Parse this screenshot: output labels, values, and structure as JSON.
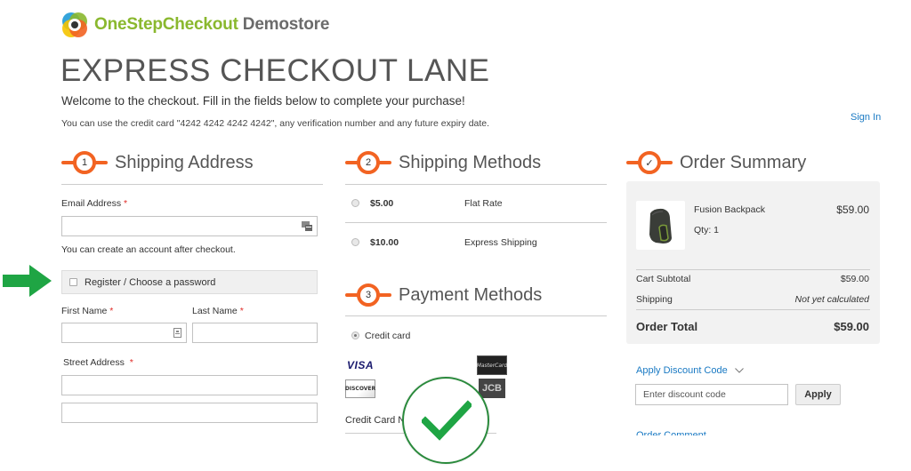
{
  "header": {
    "logo_brand": "OneStepCheckout",
    "logo_store": "Demostore",
    "page_title": "EXPRESS CHECKOUT LANE",
    "welcome": "Welcome to the checkout. Fill in the fields below to complete your purchase!",
    "hint": "You can use the credit card \"4242 4242 4242 4242\", any verification number and any future expiry date.",
    "sign_in": "Sign In"
  },
  "shipping_address": {
    "step": "1",
    "title": "Shipping Address",
    "email_label": "Email Address",
    "required_mark": "*",
    "email_value": "",
    "account_note": "You can create an account after checkout.",
    "register_label": "Register / Choose a password",
    "first_name_label": "First Name",
    "last_name_label": "Last Name",
    "street_label": "Street Address",
    "first_name_value": "",
    "last_name_value": "",
    "street_line1_value": "",
    "street_line2_value": ""
  },
  "shipping_methods": {
    "step": "2",
    "title": "Shipping Methods",
    "options": [
      {
        "price": "$5.00",
        "name": "Flat Rate",
        "selected": false
      },
      {
        "price": "$10.00",
        "name": "Express Shipping",
        "selected": false
      }
    ]
  },
  "payment_methods": {
    "step": "3",
    "title": "Payment Methods",
    "selected_method": "Credit card",
    "card_brands": [
      "VISA",
      "MasterCard",
      "DISCOVER",
      "JCB"
    ],
    "card_number_label": "Credit Card N"
  },
  "order_summary": {
    "step": "✓",
    "title": "Order Summary",
    "product": {
      "name": "Fusion Backpack",
      "qty": "Qty: 1",
      "price": "$59.00"
    },
    "subtotal_label": "Cart Subtotal",
    "subtotal_value": "$59.00",
    "shipping_label": "Shipping",
    "shipping_value": "Not yet calculated",
    "total_label": "Order Total",
    "total_value": "$59.00",
    "discount_toggle": "Apply Discount Code",
    "discount_placeholder": "Enter discount code",
    "apply_label": "Apply",
    "order_comment": "Order Comment"
  },
  "colors": {
    "accent_orange": "#f26322",
    "link_blue": "#1979c3",
    "brand_green": "#8ab82e",
    "success_green": "#1fa544"
  }
}
